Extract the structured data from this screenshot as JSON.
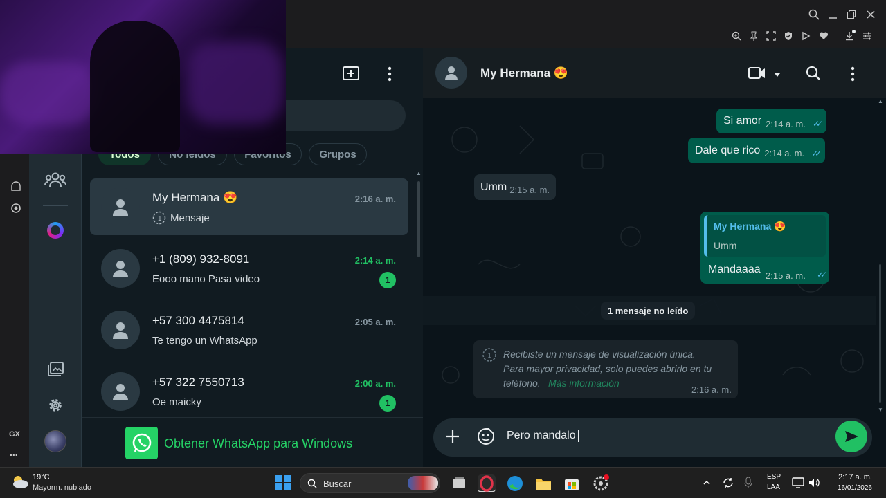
{
  "browser": {
    "toolbar_icons": [
      "zoom-icon",
      "pin-icon",
      "snapshot-icon",
      "shield-icon",
      "play-icon",
      "heart-icon",
      "download-icon",
      "settings-icon"
    ]
  },
  "wa": {
    "filters": [
      "Todos",
      "No leídos",
      "Favoritos",
      "Grupos"
    ],
    "chats": [
      {
        "name": "My Hermana 😍",
        "preview": "Mensaje",
        "time": "2:16 a. m.",
        "unread": "",
        "time_color": "#8696a0"
      },
      {
        "name": "+1 (809) 932-8091",
        "preview": "Eooo mano Pasa video",
        "time": "2:14 a. m.",
        "unread": "1",
        "time_color": "#21c063"
      },
      {
        "name": "+57 300 4475814",
        "preview": "Te tengo un WhatsApp",
        "time": "2:05 a. m.",
        "unread": "",
        "time_color": "#8696a0"
      },
      {
        "name": "+57 322 7550713",
        "preview": "Oe maicky",
        "time": "2:00 a. m.",
        "unread": "1",
        "time_color": "#21c063"
      }
    ],
    "promo_text": "Obtener WhatsApp para Windows",
    "conversation": {
      "contact": "My Hermana 😍",
      "messages": [
        {
          "dir": "out",
          "text": "Si amor",
          "time": "2:14 a. m."
        },
        {
          "dir": "out",
          "text": "Dale que rico",
          "time": "2:14 a. m."
        },
        {
          "dir": "in",
          "text": "Umm",
          "time": "2:15 a. m."
        },
        {
          "dir": "out",
          "quote_author": "My Hermana 😍",
          "quote_text": "Umm",
          "text": "Mandaaaa",
          "time": "2:15 a. m."
        }
      ],
      "unread_divider": "1 mensaje no leído",
      "view_once": {
        "line1": "Recibiste un mensaje de visualización única.",
        "line2": "Para mayor privacidad, solo puedes abrirlo en tu",
        "line3": "teléfono.",
        "link": "Más información",
        "time": "2:16 a. m."
      },
      "composer_value": "Pero mandalo"
    },
    "colors": {
      "accent": "#21c063",
      "bubble_out": "#005c4b",
      "bubble_in": "#202c33"
    }
  },
  "opera_side": {
    "label_gx": "GX",
    "more": "..."
  },
  "taskbar": {
    "weather_temp": "19°C",
    "weather_desc": "Mayorm. nublado",
    "search_placeholder": "Buscar",
    "lang_top": "ESP",
    "lang_bottom": "LAA",
    "clock_time": "2:17 a. m.",
    "clock_date": "16/01/2026"
  }
}
